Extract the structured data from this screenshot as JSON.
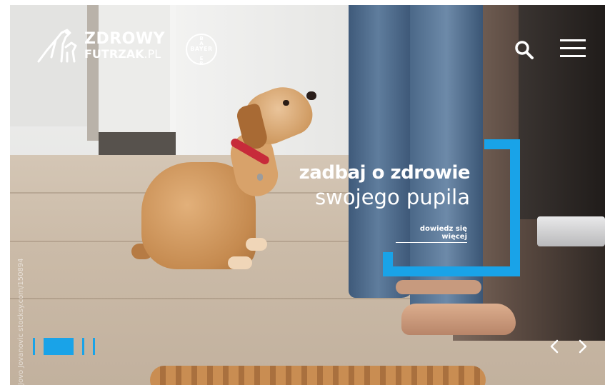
{
  "brand": {
    "logo_line1": "ZDROWY",
    "logo_line2": "FUTRZAK",
    "logo_domain": ".PL",
    "partner": "BAYER"
  },
  "header": {
    "search_icon": "search-icon",
    "menu_icon": "hamburger-menu-icon"
  },
  "hero": {
    "headline_bold": "zadbaj o zdrowie",
    "headline_light": "swojego pupila",
    "cta_label": "dowiedz się więcej",
    "photo_credit": "Jovo Jovanovic  stocksy.com/150894"
  },
  "slider": {
    "active_index": 1,
    "slide_count": 4,
    "prev_icon": "chevron-left-icon",
    "next_icon": "chevron-right-icon"
  },
  "colors": {
    "accent": "#19a3e8",
    "text": "#ffffff"
  }
}
